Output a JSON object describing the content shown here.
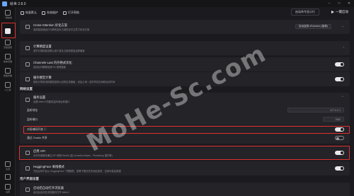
{
  "app": {
    "title": "绘世 2.8.0"
  },
  "window_controls": {
    "minimize": "–",
    "maximize": "□",
    "close": "✕"
  },
  "sidebar": {
    "items": [
      {
        "label": "一键启动",
        "icon": "play-icon"
      },
      {
        "label": "",
        "icon": "settings-panel-icon"
      },
      {
        "label": "高级选项",
        "icon": "sliders-icon"
      },
      {
        "label": "版本管理",
        "icon": "version-icon"
      },
      {
        "label": "模型管理",
        "icon": "cube-icon"
      },
      {
        "label": "小工具",
        "icon": "tools-icon"
      },
      {
        "label": "交流",
        "icon": "chat-icon"
      },
      {
        "label": "灯泡",
        "icon": "lightbulb-icon"
      },
      {
        "label": "设置",
        "icon": "gear-icon"
      }
    ]
  },
  "toolbar": {
    "buttons": [
      {
        "label": "恢复默认",
        "icon": "reset-icon"
      },
      {
        "label": "系统维护",
        "icon": "wrench-icon"
      },
      {
        "label": "打开帮助",
        "icon": "help-icon"
      }
    ],
    "launch_options_label": "启动命令显示行",
    "launch_label": "一键启动"
  },
  "rows_top": [
    {
      "title": "Cross-Attention 优化方案",
      "desc": "选择能加速运行与降低显存占用的交叉注意力优化方案",
      "control": "select",
      "value": "自动选择 xFormers (推荐)"
    },
    {
      "title": "计算精度设置",
      "desc": "调节计算精度设置以减少显存占用和提高运算速度",
      "control": "chevron"
    },
    {
      "title": "Channels-Last 内存格式优化",
      "desc": "启用后可略微加速 SD 推理速度",
      "control": "toggle",
      "on": true
    },
    {
      "title": "缓存模型计算",
      "desc": "提前计算常用的模型结构以加快生成速度，但会占用一定的内存空间和启动时间",
      "control": "toggle",
      "on": true
    }
  ],
  "network_section": {
    "title": "网络设置"
  },
  "server": {
    "title": "服务设置",
    "desc": "设置 WebUI 的服务监听地址和端口",
    "address_label": "监听地址",
    "address_value": "127.0.0.1",
    "port_label": "监听端口",
    "port_value": "7860",
    "lan_label": "对局域网开放 ⓘ",
    "lan_on": true,
    "gradio_label": "通过 Gradio 共享",
    "gradio_on": false
  },
  "api": {
    "title": "启用 API",
    "desc": "允许外部程序通过 API 调用 WebUI (如 sd-webui-helper、Photoshop 插件等)",
    "on": true
  },
  "hf": {
    "title": "HuggingFace 离线模式",
    "desc": "开启后将不会从 HuggingFace 下载模型，如需下载请先关闭此选项，否则可能会报错",
    "on": true
  },
  "user_section": {
    "title": "用户界面设置"
  },
  "auto_open": {
    "title": "启动后自动打开浏览器",
    "desc": "启动后自动在浏览器中打开 WebUI"
  }
}
